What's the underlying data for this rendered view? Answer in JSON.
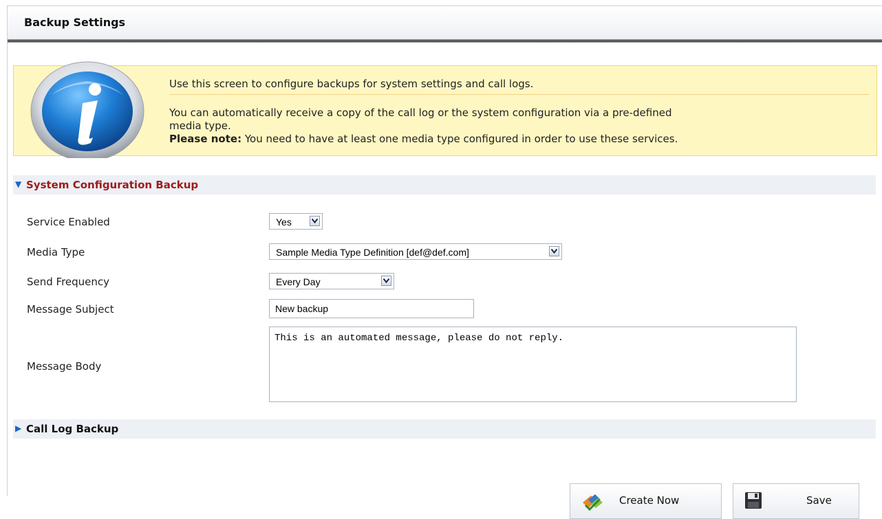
{
  "page": {
    "title": "Backup Settings"
  },
  "info": {
    "line1": "Use this screen to configure backups for system settings and call logs.",
    "line2": "You can automatically receive a copy of the call log or the system configuration via a pre-defined",
    "line3": "media type.",
    "note_bold": "Please note:",
    "note_text": " You need to have at least one media type configured in order to use these services."
  },
  "system_backup": {
    "header": "System Configuration Backup",
    "expanded": true,
    "fields": {
      "service_enabled": {
        "label": "Service Enabled",
        "value": "Yes"
      },
      "media_type": {
        "label": "Media Type",
        "value": "Sample Media Type Definition [def@def.com]"
      },
      "send_frequency": {
        "label": "Send Frequency",
        "value": "Every Day"
      },
      "message_subject": {
        "label": "Message Subject",
        "value": "New backup"
      },
      "message_body": {
        "label": "Message Body",
        "value": "This is an automated message, please do not reply."
      }
    }
  },
  "call_log_backup": {
    "header": "Call Log Backup",
    "expanded": false
  },
  "buttons": {
    "create_now": "Create Now",
    "save": "Save"
  },
  "colors": {
    "info_bg": "#fff7c2",
    "section_header_bg": "#edf0f5",
    "open_section_text": "#9c1c1c",
    "arrow": "#1e63c9"
  },
  "icons": {
    "info": "info-icon",
    "dropdown": "chevron-down-icon",
    "create_now": "backup-create-icon",
    "save": "floppy-disk-icon"
  }
}
